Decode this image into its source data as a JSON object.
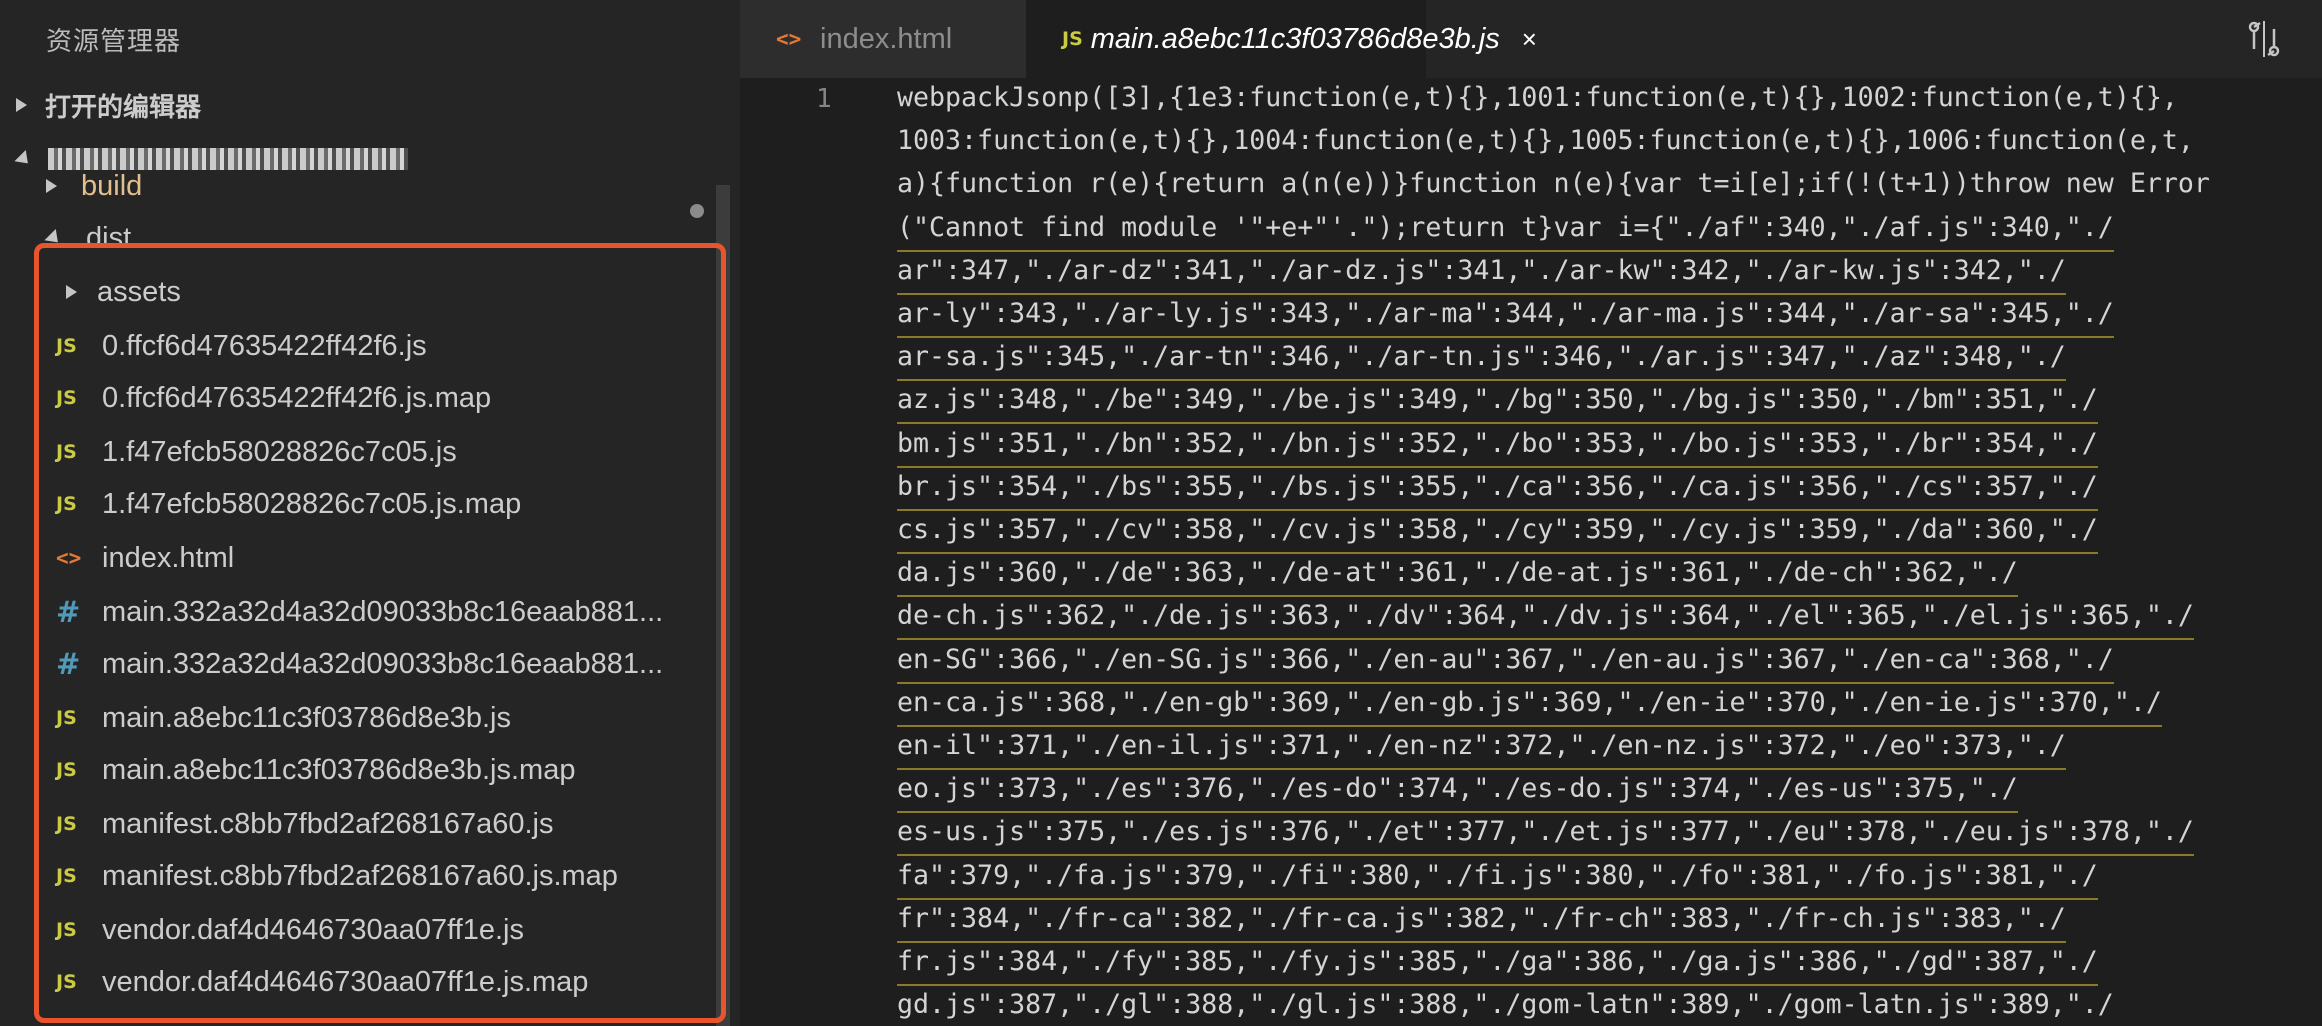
{
  "sidebar": {
    "title": "资源管理器",
    "open_editors": "打开的编辑器",
    "project": {
      "name_redacted": true
    },
    "tree": [
      {
        "type": "folder",
        "name": "build",
        "expanded": false,
        "depth": 1,
        "modified_dot": true
      },
      {
        "type": "folder",
        "name": "dist",
        "expanded": true,
        "depth": 1
      },
      {
        "type": "folder",
        "name": "assets",
        "expanded": false,
        "depth": 2
      },
      {
        "type": "file",
        "icon": "JS",
        "name": "0.ffcf6d47635422ff42f6.js"
      },
      {
        "type": "file",
        "icon": "JS",
        "name": "0.ffcf6d47635422ff42f6.js.map"
      },
      {
        "type": "file",
        "icon": "JS",
        "name": "1.f47efcb58028826c7c05.js"
      },
      {
        "type": "file",
        "icon": "JS",
        "name": "1.f47efcb58028826c7c05.js.map"
      },
      {
        "type": "file",
        "icon": "<>",
        "name": "index.html"
      },
      {
        "type": "file",
        "icon": "#",
        "name": "main.332a32d4a32d09033b8c16eaab881..."
      },
      {
        "type": "file",
        "icon": "#",
        "name": "main.332a32d4a32d09033b8c16eaab881..."
      },
      {
        "type": "file",
        "icon": "JS",
        "name": "main.a8ebc11c3f03786d8e3b.js"
      },
      {
        "type": "file",
        "icon": "JS",
        "name": "main.a8ebc11c3f03786d8e3b.js.map"
      },
      {
        "type": "file",
        "icon": "JS",
        "name": "manifest.c8bb7fbd2af268167a60.js"
      },
      {
        "type": "file",
        "icon": "JS",
        "name": "manifest.c8bb7fbd2af268167a60.js.map"
      },
      {
        "type": "file",
        "icon": "JS",
        "name": "vendor.daf4d4646730aa07ff1e.js"
      },
      {
        "type": "file",
        "icon": "JS",
        "name": "vendor.daf4d4646730aa07ff1e.js.map"
      }
    ]
  },
  "tabs": [
    {
      "icon": "<>",
      "label": "index.html",
      "active": false
    },
    {
      "icon": "JS",
      "label": "main.a8ebc11c3f03786d8e3b.js",
      "active": true,
      "close": "×"
    }
  ],
  "editor": {
    "line_number": "1",
    "wrapped_lines": [
      "webpackJsonp([3],{1e3:function(e,t){},1001:function(e,t){},1002:function(e,t){},",
      "1003:function(e,t){},1004:function(e,t){},1005:function(e,t){},1006:function(e,t,",
      "a){function r(e){return a(n(e))}function n(e){var t=i[e];if(!(t+1))throw new Error",
      "(\"Cannot find module '\"+e+\"'.\");return t}var i={\"./af\":340,\"./af.js\":340,\"./",
      "ar\":347,\"./ar-dz\":341,\"./ar-dz.js\":341,\"./ar-kw\":342,\"./ar-kw.js\":342,\"./",
      "ar-ly\":343,\"./ar-ly.js\":343,\"./ar-ma\":344,\"./ar-ma.js\":344,\"./ar-sa\":345,\"./",
      "ar-sa.js\":345,\"./ar-tn\":346,\"./ar-tn.js\":346,\"./ar.js\":347,\"./az\":348,\"./",
      "az.js\":348,\"./be\":349,\"./be.js\":349,\"./bg\":350,\"./bg.js\":350,\"./bm\":351,\"./",
      "bm.js\":351,\"./bn\":352,\"./bn.js\":352,\"./bo\":353,\"./bo.js\":353,\"./br\":354,\"./",
      "br.js\":354,\"./bs\":355,\"./bs.js\":355,\"./ca\":356,\"./ca.js\":356,\"./cs\":357,\"./",
      "cs.js\":357,\"./cv\":358,\"./cv.js\":358,\"./cy\":359,\"./cy.js\":359,\"./da\":360,\"./",
      "da.js\":360,\"./de\":363,\"./de-at\":361,\"./de-at.js\":361,\"./de-ch\":362,\"./",
      "de-ch.js\":362,\"./de.js\":363,\"./dv\":364,\"./dv.js\":364,\"./el\":365,\"./el.js\":365,\"./",
      "en-SG\":366,\"./en-SG.js\":366,\"./en-au\":367,\"./en-au.js\":367,\"./en-ca\":368,\"./",
      "en-ca.js\":368,\"./en-gb\":369,\"./en-gb.js\":369,\"./en-ie\":370,\"./en-ie.js\":370,\"./",
      "en-il\":371,\"./en-il.js\":371,\"./en-nz\":372,\"./en-nz.js\":372,\"./eo\":373,\"./",
      "eo.js\":373,\"./es\":376,\"./es-do\":374,\"./es-do.js\":374,\"./es-us\":375,\"./",
      "es-us.js\":375,\"./es.js\":376,\"./et\":377,\"./et.js\":377,\"./eu\":378,\"./eu.js\":378,\"./",
      "fa\":379,\"./fa.js\":379,\"./fi\":380,\"./fi.js\":380,\"./fo\":381,\"./fo.js\":381,\"./",
      "fr\":384,\"./fr-ca\":382,\"./fr-ca.js\":382,\"./fr-ch\":383,\"./fr-ch.js\":383,\"./",
      "fr.js\":384,\"./fy\":385,\"./fy.js\":385,\"./ga\":386,\"./ga.js\":386,\"./gd\":387,\"./",
      "gd.js\":387,\"./gl\":388,\"./gl.js\":388,\"./gom-latn\":389,\"./gom-latn.js\":389,\"./"
    ]
  }
}
